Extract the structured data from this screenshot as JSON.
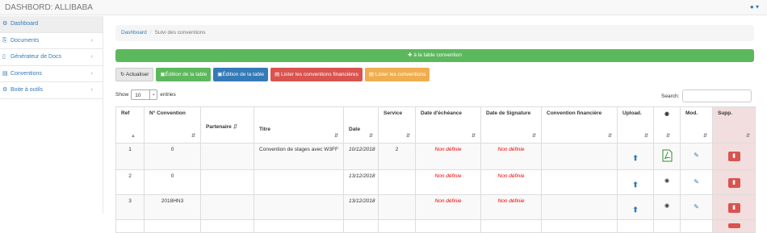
{
  "app": {
    "title": "DASHBORD: ALLIBABA",
    "user_icon": "user-icon",
    "caret": "▾"
  },
  "sidebar": {
    "items": [
      {
        "label": "Dashboard",
        "icon": "dashboard-icon",
        "glyph": "⚙",
        "arrow": ""
      },
      {
        "label": "Documents",
        "icon": "documents-icon",
        "glyph": "⎘",
        "arrow": "‹"
      },
      {
        "label": "Générateur de Docs",
        "icon": "file-icon",
        "glyph": "▯",
        "arrow": "‹"
      },
      {
        "label": "Conventions",
        "icon": "table-icon",
        "glyph": "▤",
        "arrow": "‹"
      },
      {
        "label": "Boite à outils",
        "icon": "tools-icon",
        "glyph": "⚙",
        "arrow": "‹"
      }
    ]
  },
  "breadcrumb": {
    "home": "Dashboard",
    "separator": "/",
    "current": "Suivi des conventions"
  },
  "add_bar": {
    "label": "à la table convention",
    "icon": "plus-circle-icon",
    "glyph": "✚"
  },
  "toolbar": {
    "refresh": "Actualiser",
    "edit_table_green": "Édition de la table",
    "edit_table_blue": "Édition de la table",
    "list_financial": "Lister les conventions financières",
    "list_conventions": "Lister les conventions"
  },
  "length_menu": {
    "show": "Show",
    "value": "10",
    "entries": "entries"
  },
  "search": {
    "label": "Search:",
    "value": ""
  },
  "table": {
    "headers": [
      "Ref",
      "N° Convention",
      "Partenaire",
      "Titre",
      "Date",
      "Service",
      "Date d'échéance",
      "Date de Signature",
      "Convention financière",
      "Upload.",
      "",
      "Mod.",
      "Supp."
    ],
    "rows": [
      {
        "ref": "1",
        "num": "0",
        "partenaire": "",
        "titre": "Convention de stages avec W3FF",
        "date": "10/12/2018",
        "service": "2",
        "echeance": "Non définie",
        "signature": "Non définie",
        "financiere": "",
        "view": "pdf"
      },
      {
        "ref": "2",
        "num": "0",
        "partenaire": "",
        "titre": "",
        "date": "13/12/2018",
        "service": "",
        "echeance": "Non définie",
        "signature": "Non définie",
        "financiere": "",
        "view": "eye"
      },
      {
        "ref": "3",
        "num": "2018HN3",
        "partenaire": "",
        "titre": "",
        "date": "13/12/2018",
        "service": "",
        "echeance": "Non définie",
        "signature": "Non définie",
        "financiere": "",
        "view": "eye"
      }
    ]
  },
  "colors": {
    "green": "#5cb85c",
    "blue": "#337ab7",
    "red": "#d9534f",
    "orange": "#f0ad4e",
    "nondef": "#e00000"
  }
}
